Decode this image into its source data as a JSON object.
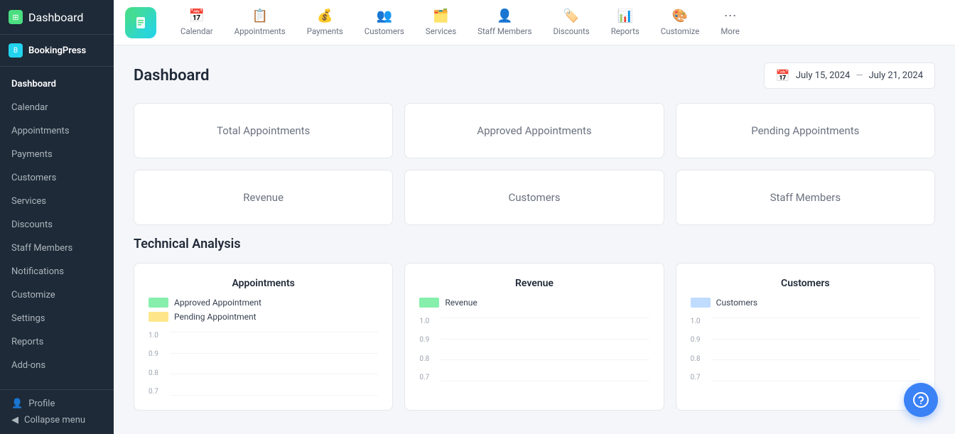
{
  "app": {
    "title": "Dashboard",
    "brand": "BookingPress"
  },
  "sidebar": {
    "items": [
      {
        "id": "dashboard",
        "label": "Dashboard",
        "active": true
      },
      {
        "id": "calendar",
        "label": "Calendar",
        "active": false
      },
      {
        "id": "appointments",
        "label": "Appointments",
        "active": false
      },
      {
        "id": "payments",
        "label": "Payments",
        "active": false
      },
      {
        "id": "customers",
        "label": "Customers",
        "active": false
      },
      {
        "id": "services",
        "label": "Services",
        "active": false
      },
      {
        "id": "discounts",
        "label": "Discounts",
        "active": false
      },
      {
        "id": "staff-members",
        "label": "Staff Members",
        "active": false
      },
      {
        "id": "notifications",
        "label": "Notifications",
        "active": false
      },
      {
        "id": "customize",
        "label": "Customize",
        "active": false
      },
      {
        "id": "settings",
        "label": "Settings",
        "active": false
      },
      {
        "id": "reports",
        "label": "Reports",
        "active": false
      },
      {
        "id": "add-ons",
        "label": "Add-ons",
        "active": false
      }
    ],
    "profile_label": "Profile",
    "collapse_label": "Collapse menu"
  },
  "topnav": {
    "items": [
      {
        "id": "calendar",
        "label": "Calendar",
        "icon": "📅"
      },
      {
        "id": "appointments",
        "label": "Appointments",
        "icon": "📋"
      },
      {
        "id": "payments",
        "label": "Payments",
        "icon": "💰"
      },
      {
        "id": "customers",
        "label": "Customers",
        "icon": "👥"
      },
      {
        "id": "services",
        "label": "Services",
        "icon": "🗂️"
      },
      {
        "id": "staff-members",
        "label": "Staff Members",
        "icon": "👤"
      },
      {
        "id": "discounts",
        "label": "Discounts",
        "icon": "🏷️"
      },
      {
        "id": "reports",
        "label": "Reports",
        "icon": "📊"
      },
      {
        "id": "customize",
        "label": "Customize",
        "icon": "🎨"
      },
      {
        "id": "more",
        "label": "More",
        "icon": "⋯"
      }
    ]
  },
  "dashboard": {
    "title": "Dashboard",
    "date_from": "July 15, 2024",
    "date_to": "July 21, 2024",
    "stats": [
      {
        "id": "total-appointments",
        "label": "Total Appointments"
      },
      {
        "id": "approved-appointments",
        "label": "Approved Appointments"
      },
      {
        "id": "pending-appointments",
        "label": "Pending Appointments"
      },
      {
        "id": "revenue",
        "label": "Revenue"
      },
      {
        "id": "customers",
        "label": "Customers"
      },
      {
        "id": "staff-members",
        "label": "Staff Members"
      }
    ]
  },
  "technical_analysis": {
    "title": "Technical Analysis",
    "charts": [
      {
        "id": "appointments-chart",
        "title": "Appointments",
        "legend": [
          {
            "label": "Approved Appointment",
            "color": "#86efac"
          },
          {
            "label": "Pending Appointment",
            "color": "#fde68a"
          }
        ],
        "y_axis": [
          "1.0",
          "0.9",
          "0.8",
          "0.7"
        ]
      },
      {
        "id": "revenue-chart",
        "title": "Revenue",
        "legend": [
          {
            "label": "Revenue",
            "color": "#86efac"
          }
        ],
        "y_axis": [
          "1.0",
          "0.9",
          "0.8",
          "0.7"
        ]
      },
      {
        "id": "customers-chart",
        "title": "Customers",
        "legend": [
          {
            "label": "Customers",
            "color": "#bfdbfe"
          }
        ],
        "y_axis": [
          "1.0",
          "0.9",
          "0.8",
          "0.7"
        ]
      }
    ]
  }
}
